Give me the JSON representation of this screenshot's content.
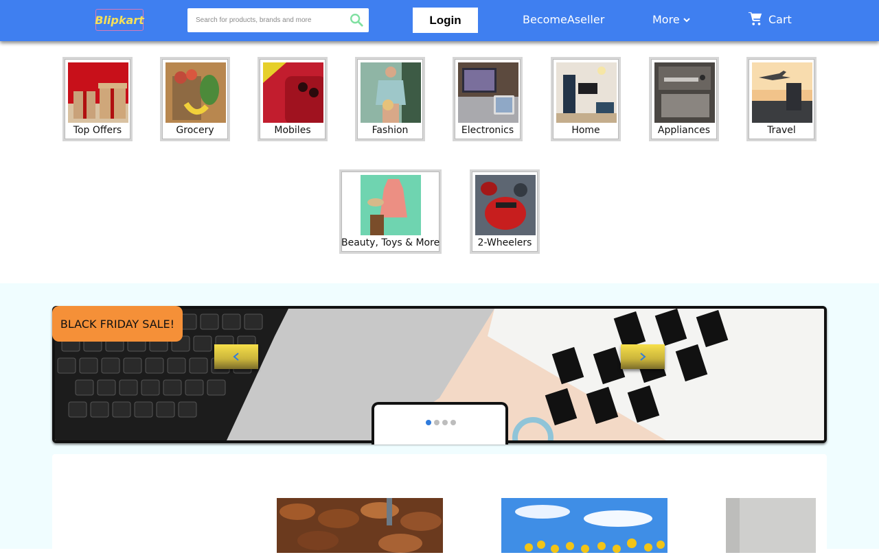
{
  "header": {
    "logo": "Blipkart",
    "search_placeholder": "Search for products, brands and more",
    "login": "Login",
    "seller": "BecomeAseller",
    "more": "More",
    "cart": "Cart"
  },
  "categories": [
    {
      "label": "Top Offers",
      "icon": "gift-boxes-image"
    },
    {
      "label": "Grocery",
      "icon": "grocery-bag-image"
    },
    {
      "label": "Mobiles",
      "icon": "phone-image"
    },
    {
      "label": "Fashion",
      "icon": "fashion-model-image"
    },
    {
      "label": "Electronics",
      "icon": "laptop-tablet-image"
    },
    {
      "label": "Home",
      "icon": "living-room-image"
    },
    {
      "label": "Appliances",
      "icon": "oven-image"
    },
    {
      "label": "Travel",
      "icon": "airport-image"
    },
    {
      "label": "Beauty, Toys & More",
      "icon": "dress-hat-image"
    },
    {
      "label": "2-Wheelers",
      "icon": "scooter-image"
    }
  ],
  "banner": {
    "tag": "BLACK FRIDAY SALE!",
    "slide_count": 4,
    "active_slide": 1
  },
  "colors": {
    "header": "#3f7ff0",
    "logo_text": "#f5e05a",
    "tag": "#f59038",
    "zone_bg": "#f0fdff",
    "dot_active": "#2f7bdc"
  }
}
